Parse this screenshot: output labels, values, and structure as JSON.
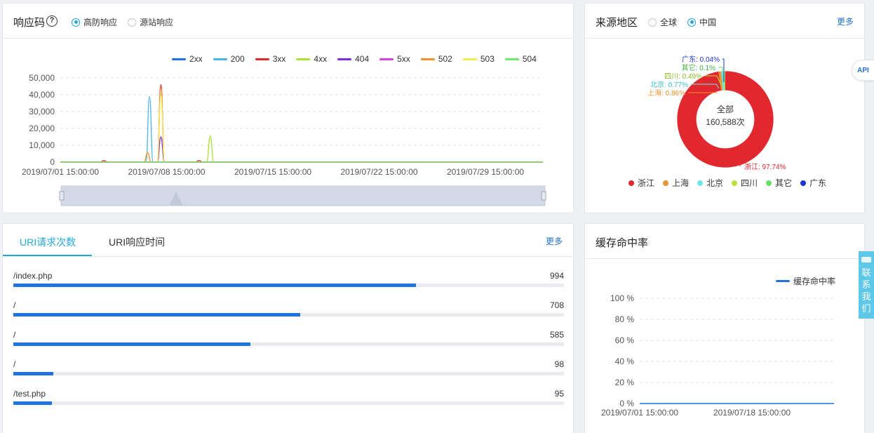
{
  "response_panel": {
    "title": "响应码",
    "help_glyph": "?",
    "radio_options": [
      {
        "label": "高防响应",
        "checked": true
      },
      {
        "label": "源站响应",
        "checked": false
      }
    ],
    "legend": [
      {
        "name": "2xx",
        "color": "#1f6fe5"
      },
      {
        "name": "200",
        "color": "#4ab4ea"
      },
      {
        "name": "3xx",
        "color": "#e02a2a"
      },
      {
        "name": "4xx",
        "color": "#a6e22e"
      },
      {
        "name": "404",
        "color": "#7b2be0"
      },
      {
        "name": "5xx",
        "color": "#e040e0"
      },
      {
        "name": "502",
        "color": "#f0912a"
      },
      {
        "name": "503",
        "color": "#f2ec4c"
      },
      {
        "name": "504",
        "color": "#6ee86e"
      }
    ]
  },
  "chart_data": [
    {
      "type": "line",
      "y_ticks": [
        "50,000",
        "40,000",
        "30,000",
        "20,000",
        "10,000",
        "0"
      ],
      "ylim": [
        0,
        50000
      ],
      "x_ticks": [
        "2019/07/01 15:00:00",
        "2019/07/08 15:00:00",
        "2019/07/15 15:00:00",
        "2019/07/22 15:00:00",
        "2019/07/29 15:00:00"
      ],
      "grid": true,
      "legend_position": "top-right",
      "series": [
        {
          "name": "2xx",
          "peaks": []
        },
        {
          "name": "200",
          "peaks": [
            {
              "x": "2019/07/07 12:00",
              "y": 39000
            }
          ]
        },
        {
          "name": "3xx",
          "peaks": [
            {
              "x": "2019/07/08 06:00",
              "y": 46000
            },
            {
              "x": "2019/07/04 12:00",
              "y": 1000
            },
            {
              "x": "2019/07/10 18:00",
              "y": 1000
            }
          ]
        },
        {
          "name": "4xx",
          "peaks": [
            {
              "x": "2019/07/11 12:00",
              "y": 15500
            }
          ]
        },
        {
          "name": "404",
          "peaks": [
            {
              "x": "2019/07/08 06:00",
              "y": 15000
            }
          ]
        },
        {
          "name": "5xx",
          "peaks": []
        },
        {
          "name": "502",
          "peaks": [
            {
              "x": "2019/07/08 06:00",
              "y": 44000
            },
            {
              "x": "2019/07/07 09:00",
              "y": 5500
            }
          ]
        },
        {
          "name": "503",
          "peaks": [
            {
              "x": "2019/07/08 06:00",
              "y": 40000
            }
          ]
        },
        {
          "name": "504",
          "peaks": []
        }
      ]
    },
    {
      "type": "pie",
      "center_label": "全部",
      "center_value": "160,588次",
      "slices": [
        {
          "name": "浙江",
          "percent": 97.74,
          "label": "浙江: 97.74%",
          "color": "#e0282e"
        },
        {
          "name": "上海",
          "percent": 0.86,
          "label": "上海: 0.86%",
          "color": "#f0902e"
        },
        {
          "name": "北京",
          "percent": 0.77,
          "label": "北京: 0.77%",
          "color": "#6ee6e6"
        },
        {
          "name": "四川",
          "percent": 0.49,
          "label": "四川: 0.49%",
          "color": "#b6e33a"
        },
        {
          "name": "其它",
          "percent": 0.1,
          "label": "其它: 0.1%",
          "color": "#66e06a"
        },
        {
          "name": "广东",
          "percent": 0.04,
          "label": "广东: 0.04%",
          "color": "#1a34d8"
        }
      ]
    },
    {
      "type": "line",
      "legend": "缓存命中率",
      "series": [
        {
          "name": "缓存命中率",
          "values": [
            0,
            0
          ]
        }
      ],
      "y_ticks": [
        "100 %",
        "80 %",
        "60 %",
        "40 %",
        "20 %",
        "0 %"
      ],
      "x_ticks": [
        "2019/07/01 15:00:00",
        "2019/07/18 15:00:00"
      ],
      "ylim": [
        0,
        100
      ],
      "grid": true,
      "legend_position": "top-right"
    }
  ],
  "region_panel": {
    "title": "来源地区",
    "radio_options": [
      {
        "label": "全球",
        "checked": false
      },
      {
        "label": "中国",
        "checked": true
      }
    ],
    "more": "更多",
    "legend": [
      {
        "name": "浙江",
        "color": "#e0282e"
      },
      {
        "name": "上海",
        "color": "#f0902e"
      },
      {
        "name": "北京",
        "color": "#6ee6e6"
      },
      {
        "name": "四川",
        "color": "#b6e33a"
      },
      {
        "name": "其它",
        "color": "#66e06a"
      },
      {
        "name": "广东",
        "color": "#1a34d8"
      }
    ]
  },
  "uri_panel": {
    "tabs": [
      {
        "label": "URI请求次数",
        "active": true
      },
      {
        "label": "URI响应时间",
        "active": false
      }
    ],
    "more": "更多",
    "max": 1360,
    "rows": [
      {
        "path": "/index.php",
        "count": "994",
        "value": 994
      },
      {
        "path": "/",
        "count": "708",
        "value": 708
      },
      {
        "path": "/",
        "count": "585",
        "value": 585
      },
      {
        "path": "/",
        "count": "98",
        "value": 98
      },
      {
        "path": "/test.php",
        "count": "95",
        "value": 95
      }
    ]
  },
  "cache_panel": {
    "title": "缓存命中率",
    "legend_label": "缓存命中率",
    "line_color": "#1f74e0"
  },
  "floating": {
    "api_label": "API",
    "contact_label": "联系我们"
  },
  "colors": {
    "accent": "#25a8d8",
    "link": "#2473c9",
    "bar": "#1f74e0"
  }
}
